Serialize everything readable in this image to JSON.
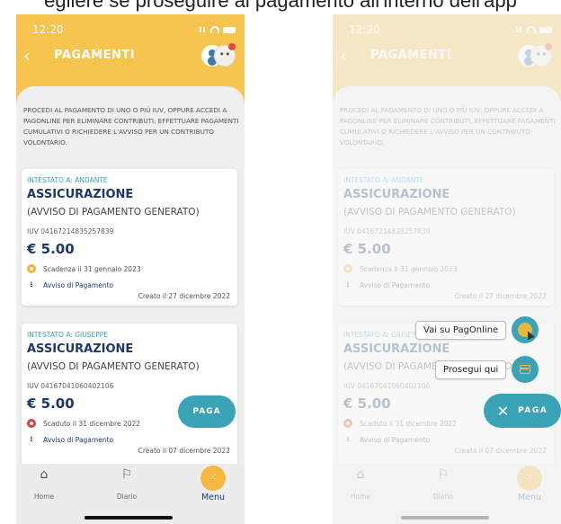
{
  "caption": "egliere se proseguire al pagamento all'interno dell'app",
  "status_time": "12:20",
  "header_title": "PAGAMENTI",
  "intro_text": "PROCEDI AL PAGAMENTO DI UNO O PIÙ IUV, OPPURE ACCEDI A PAGONLINE PER ELIMINARE CONTRIBUTI, EFFETTUARE PAGAMENTI CUMULATIVI O RICHIEDERE L'AVVISO PER UN CONTRIBUTO VOLONTARIO.",
  "cards": [
    {
      "holder": "INTESTATO A: ANDANTE",
      "title": "ASSICURAZIONE",
      "subtitle": "(AVVISO DI PAGAMENTO GENERATO)",
      "iuv": "IUV 04167214835257839",
      "amount": "€ 5.00",
      "due": "Scadenza il 31 gennaio 2023",
      "due_color": "#f0b43c",
      "download": "Avviso di Pagamento",
      "created": "Creato il 27 dicembre 2022"
    },
    {
      "holder": "INTESTATO A: GIUSEPPE",
      "title": "ASSICURAZIONE",
      "subtitle": "(AVVISO DI PAGAMENTO GENERATO)",
      "iuv": "IUV 04167041060402106",
      "amount": "€ 5.00",
      "due": "Scaduto il 31 dicembre 2022",
      "due_color": "#d9443a",
      "download": "Avviso di Pagamento",
      "created": "Creato il 07 dicembre 2022"
    }
  ],
  "paga_label": "PAGA",
  "nav": {
    "home": "Home",
    "diario": "Diario",
    "menu": "Menu"
  },
  "fab_menu": {
    "pagonline": "Vai su PagOnline",
    "prosegui": "Prosegui qui"
  },
  "colors": {
    "header": "#f7c44f",
    "accent": "#3aa3b8",
    "navy": "#1d3869",
    "menu": "#f5b73d"
  }
}
